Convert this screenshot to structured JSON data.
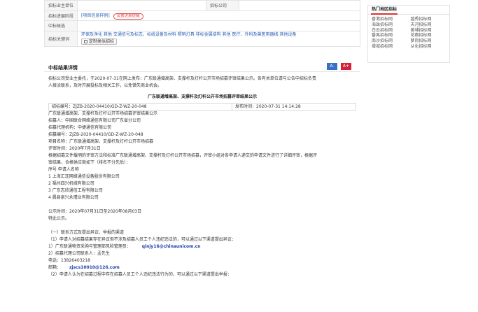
{
  "info": {
    "row1_label": "招标业主单位",
    "row1_value": "",
    "row1_label2": "招标公司",
    "row1_value2": "",
    "row2_label": "招标进展阶段",
    "row2_link": "[项目信息样例]",
    "row2_badge": "设置进展提醒",
    "row3_label": "中标候选",
    "row3_value": "",
    "row4_label": "招标关键词",
    "keywords": "环保及净化  其他  交通信号及标志、标线设备及材料  照明灯具  非标金属结构  其他  医疗、外科及兽医用器械  其他设备",
    "subscribe_label": "定制类似招标"
  },
  "sidebar": {
    "title": "热门地区招标",
    "items": [
      "香港招标网",
      "越秀招标网",
      "海珠招标网",
      "天河招标网",
      "白云招标网",
      "黄埔招标网",
      "番禺招标网",
      "花都招标网",
      "南沙招标网",
      "萝岗招标网",
      "增城招标网",
      "从化招标网"
    ]
  },
  "section": {
    "title": "中标结果详情",
    "font_small": "A-",
    "font_big": "A+"
  },
  "article": {
    "intro": [
      "招标公司受业主委托，于2020-07-31在网上发布：广东联通增高架、支撑杆及灯杆公开市场招募评审结果公示。各有关单位请与公告中招标负责",
      "人接洽联系，及时开展投标及相关工作，以免错失商业机会。"
    ],
    "doc_title": "广东联通增高架、支撑杆及灯杆公开市场招募评审结果公示",
    "doc_no": "招标编号：ZJZB-2020-04410/GD-Z-WZ-20-048",
    "publish_time": "发布时间：2020-07-31 14:14:28",
    "lines": [
      "广东联通增高架、支撑杆及灯杆公开市场招募评审结果公示",
      "招募人：中国联合网络通信有限公司广东省分公司",
      "招募代理机构：中捷通信有限公司",
      "招募编号：ZJZB-2020-04410/GD-Z-WZ-20-048",
      "项目名称：广东联通增高架、支撑杆及灯杆公开市场招募",
      "评审时间：2020年7月31日",
      "根据招募文件载明的评审方法和标准广东联通增高架、支撑杆及灯杆公开市场招募，评审小组对各申请人递交的申请文件进行了详细评审，根据评",
      "审结果，合格供应商如下（排名不分先后）：",
      "序号  申请人名称",
      "1 上海汇珏网络通信设备股份有限公司",
      "2 福州四兴机械有限公司",
      "3 广东志欣通信工程有限公司",
      "4 晨县泉兴永瑾业有限公司"
    ],
    "publicity_period": "公示时间：2020年07月31日至2020年08月03日",
    "notice": "特此公示。",
    "contact_lines": [
      "（一）联系方式及提出异议、举报的渠道",
      "（1）申请人对招募结果存在异议但不涉及招募人员工个人违纪违法的，可以通过以下渠道提出异议：",
      "1）广东联通物资采购与管理部风险管理员：",
      "2）招募代理公司联系人：孟先生",
      "电话：13826403218",
      "邮箱：",
      "（2）申请人认为在招募过程中存在招募人员工个人违纪违法行为的，可以通过以下渠道提出举报："
    ],
    "email1": "qinjy16@chinaunicom.cn",
    "email2": "zjscs10010@126.com"
  }
}
